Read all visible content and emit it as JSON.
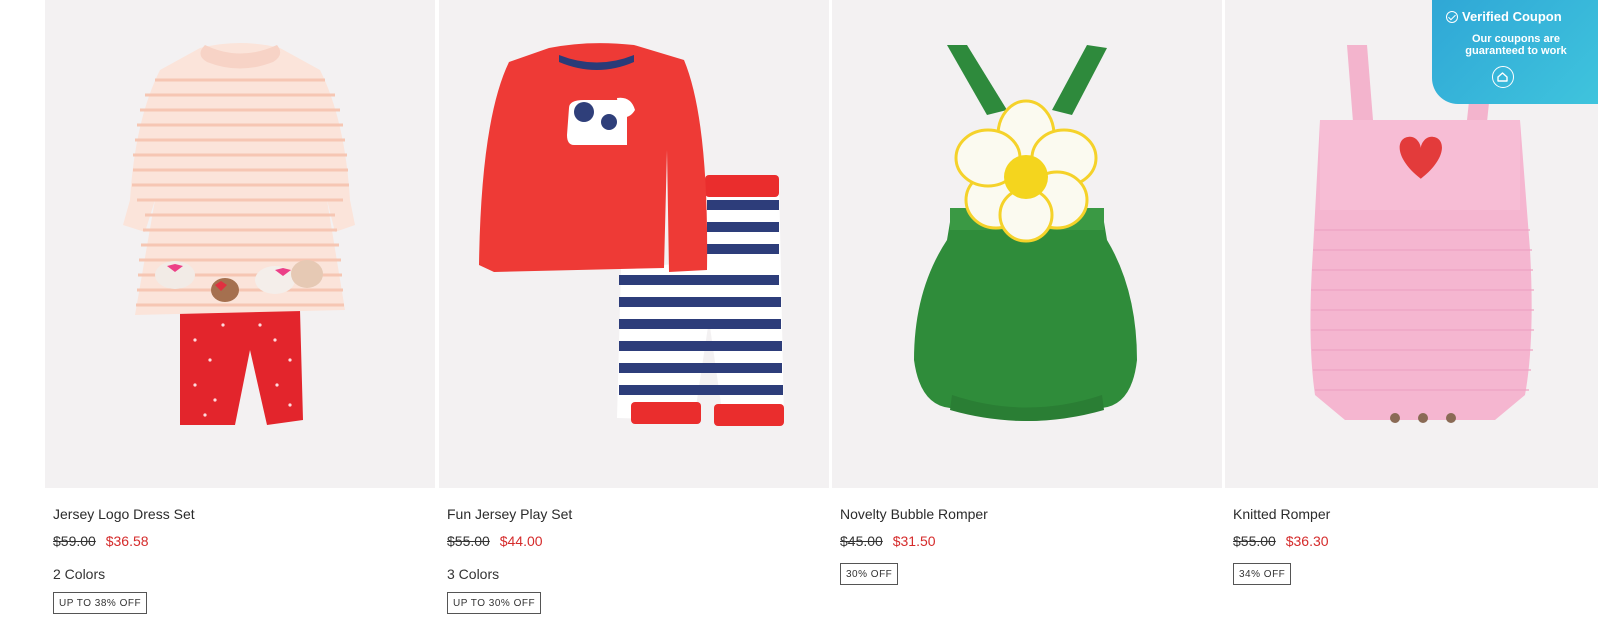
{
  "products": [
    {
      "name": "Jersey Logo Dress Set",
      "old_price": "$59.00",
      "sale_price": "$36.58",
      "colors": "2 Colors",
      "badge": "UP TO 38% OFF",
      "image": "striped-dress-with-red-leggings"
    },
    {
      "name": "Fun Jersey Play Set",
      "old_price": "$55.00",
      "sale_price": "$44.00",
      "colors": "3 Colors",
      "badge": "UP TO 30% OFF",
      "image": "red-cow-top-with-striped-pants"
    },
    {
      "name": "Novelty Bubble Romper",
      "old_price": "$45.00",
      "sale_price": "$31.50",
      "colors": "",
      "badge": "30% OFF",
      "image": "green-flower-romper"
    },
    {
      "name": "Knitted Romper",
      "old_price": "$55.00",
      "sale_price": "$36.30",
      "colors": "",
      "badge": "34% OFF",
      "image": "pink-heart-knitted-romper"
    }
  ],
  "coupon": {
    "title": "Verified Coupon",
    "subtitle": "Our coupons are guaranteed to work",
    "icon": "home-icon"
  },
  "colors": {
    "image_bg": "#f3f1f2",
    "sale_red": "#d52b2b",
    "coupon_blue": "#2fa7d6"
  }
}
